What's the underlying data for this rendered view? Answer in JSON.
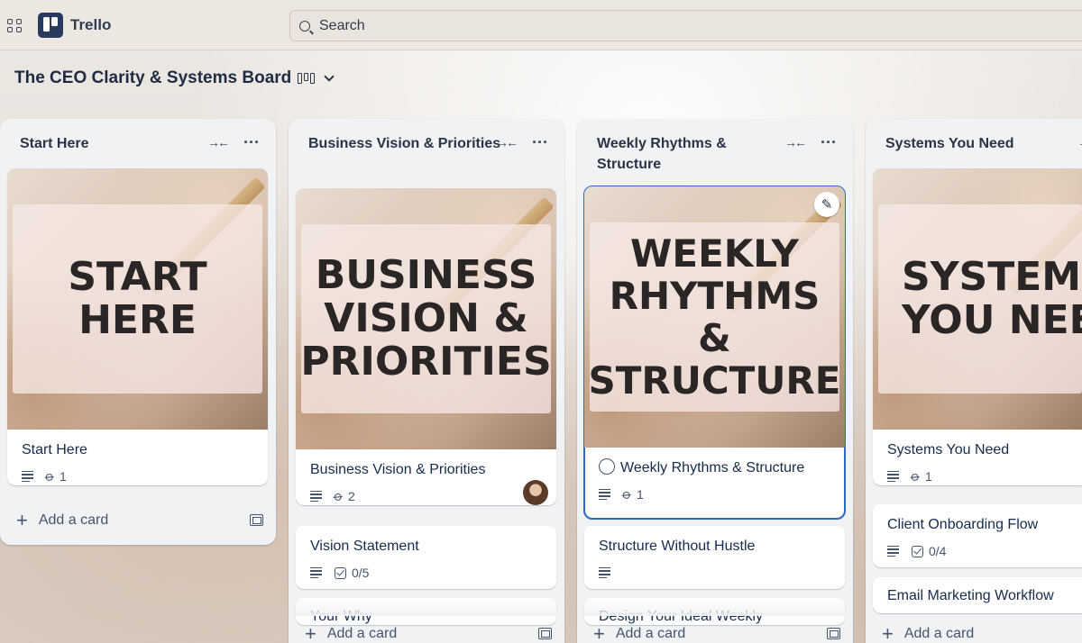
{
  "app": {
    "name": "Trello"
  },
  "search": {
    "placeholder": "Search"
  },
  "board": {
    "title": "The CEO Clarity & Systems Board"
  },
  "lists": [
    {
      "title": "Start Here",
      "cards": [
        {
          "cover_text": "START\nHERE",
          "title": "Start Here",
          "attachments": "1"
        }
      ],
      "add_label": "Add a card"
    },
    {
      "title": "Business Vision & Priorities",
      "cards": [
        {
          "cover_text": "BUSINESS\nVISION &\nPRIORITIES",
          "title": "Business Vision & Priorities",
          "attachments": "2"
        },
        {
          "title": "Vision Statement",
          "checklist": "0/5"
        },
        {
          "title": "Your Why"
        }
      ],
      "add_label": "Add a card"
    },
    {
      "title": "Weekly Rhythms & Structure",
      "cards": [
        {
          "cover_text": "WEEKLY\nRHYTHMS\n&\nSTRUCTURE",
          "title": "Weekly Rhythms & Structure",
          "attachments": "1"
        },
        {
          "title": "Structure Without Hustle"
        },
        {
          "title": "Design Your Ideal Weekly"
        }
      ],
      "add_label": "Add a card"
    },
    {
      "title": "Systems You Need",
      "cards": [
        {
          "cover_text": "SYSTEMS\nYOU NEED",
          "title": "Systems You Need",
          "attachments": "1"
        },
        {
          "title": "Client Onboarding Flow",
          "checklist": "0/4"
        },
        {
          "title": "Email Marketing Workflow"
        }
      ],
      "add_label": "Add a card"
    }
  ]
}
